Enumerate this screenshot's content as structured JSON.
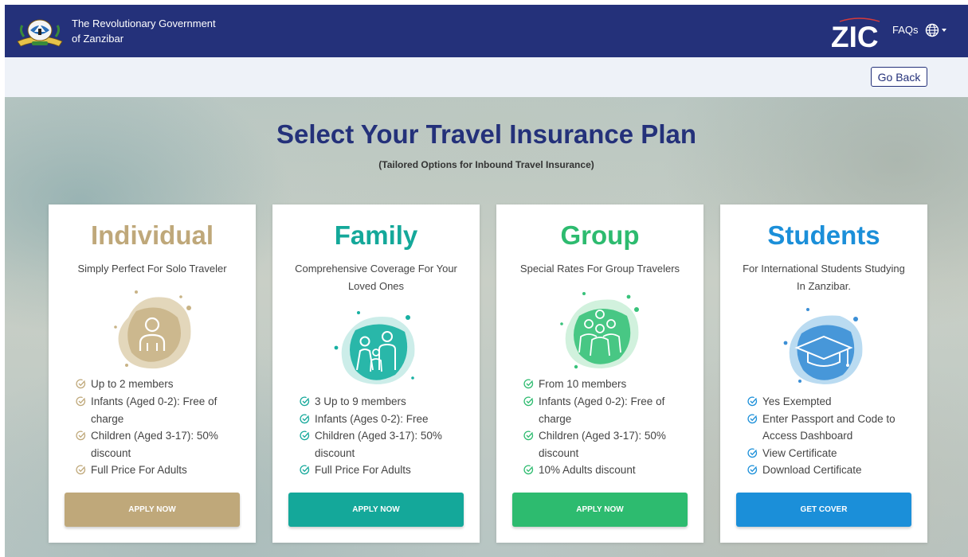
{
  "header": {
    "gov_title_line1": "The Revolutionary Government",
    "gov_title_line2": "of Zanzibar",
    "faqs_label": "FAQs",
    "logo_text": "ZIC"
  },
  "subbar": {
    "go_back_label": "Go Back"
  },
  "hero": {
    "title": "Select Your Travel Insurance Plan",
    "subtitle": "(Tailored Options for Inbound Travel Insurance)"
  },
  "colors": {
    "header_bg": "#24317a",
    "individual": "#bfa87a",
    "family": "#14a89a",
    "group": "#2dbb6f",
    "students": "#1b8fd9"
  },
  "plans": [
    {
      "title": "Individual",
      "tagline_line1": "Simply Perfect For Solo Traveler",
      "tagline_line2": "",
      "icon": "person-icon",
      "features": [
        "Up to 2 members",
        "Infants (Aged 0-2): Free of",
        "charge",
        "Children (Aged 3-17): 50%",
        "discount",
        "Full Price For Adults"
      ],
      "button": "APPLY NOW"
    },
    {
      "title": "Family",
      "tagline_line1": "Comprehensive Coverage For Your",
      "tagline_line2": "Loved Ones",
      "icon": "family-icon",
      "features": [
        "3 Up to 9 members",
        "Infants (Ages 0-2): Free",
        "Children (Aged 3-17): 50%",
        "discount",
        "Full Price For Adults"
      ],
      "button": "APPLY NOW"
    },
    {
      "title": "Group",
      "tagline_line1": "Special Rates For Group Travelers",
      "tagline_line2": "",
      "icon": "group-icon",
      "features": [
        "From 10 members",
        "Infants (Aged 0-2): Free of",
        "charge",
        "Children (Aged 3-17): 50%",
        "discount",
        "10% Adults discount"
      ],
      "button": "APPLY NOW"
    },
    {
      "title": "Students",
      "tagline_line1": "For International Students Studying",
      "tagline_line2": "In Zanzibar.",
      "icon": "graduation-cap-icon",
      "features": [
        "Yes Exempted",
        "Enter Passport and Code to",
        "Access Dashboard",
        "View Certificate",
        "Download Certificate"
      ],
      "button": "GET COVER"
    }
  ]
}
